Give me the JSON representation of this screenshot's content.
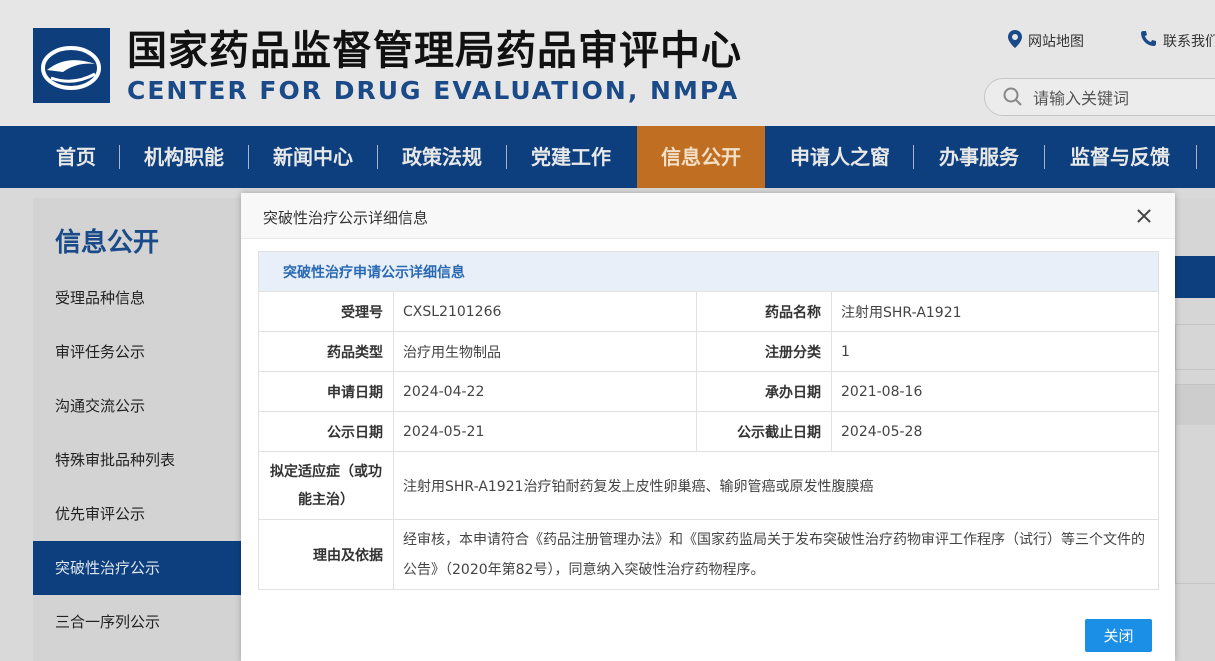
{
  "header": {
    "title_cn": "国家药品监督管理局药品审评中心",
    "title_en": "CENTER FOR DRUG EVALUATION, NMPA",
    "links": [
      {
        "label": "网站地图",
        "icon": "location-pin-icon"
      },
      {
        "label": "联系我们",
        "icon": "phone-icon"
      }
    ],
    "search": {
      "placeholder": "请输入关键词"
    }
  },
  "nav": {
    "items": [
      "首页",
      "机构职能",
      "新闻中心",
      "政策法规",
      "党建工作",
      "信息公开",
      "申请人之窗",
      "办事服务",
      "监督与反馈"
    ],
    "active": "信息公开"
  },
  "sidebar": {
    "title": "信息公开",
    "items": [
      "受理品种信息",
      "审评任务公示",
      "沟通交流公示",
      "特殊审批品种列表",
      "优先审评公示",
      "突破性治疗公示",
      "三合一序列公示"
    ],
    "active": "突破性治疗公示"
  },
  "modal": {
    "title": "突破性治疗公示详细信息",
    "caption": "突破性治疗申请公示详细信息",
    "fields": {
      "accept_no": {
        "label": "受理号",
        "value": "CXSL2101266"
      },
      "drug_name": {
        "label": "药品名称",
        "value": "注射用SHR-A1921"
      },
      "drug_type": {
        "label": "药品类型",
        "value": "治疗用生物制品"
      },
      "reg_class": {
        "label": "注册分类",
        "value": "1"
      },
      "apply_date": {
        "label": "申请日期",
        "value": "2024-04-22"
      },
      "handle_date": {
        "label": "承办日期",
        "value": "2021-08-16"
      },
      "publish_date": {
        "label": "公示日期",
        "value": "2024-05-21"
      },
      "publish_end": {
        "label": "公示截止日期",
        "value": "2024-05-28"
      },
      "indication": {
        "label": "拟定适应症（或功能主治）",
        "value": "注射用SHR-A1921治疗铂耐药复发上皮性卵巢癌、输卵管癌或原发性腹膜癌"
      },
      "reason": {
        "label": "理由及依据",
        "value": "经审核，本申请符合《药品注册管理办法》和《国家药监局关于发布突破性治疗药物审评工作程序（试行）等三个文件的公告》（2020年第82号），同意纳入突破性治疗药物程序。"
      }
    },
    "close_button": "关闭"
  },
  "colors": {
    "nav_bg": "#0d3f7e",
    "nav_active": "#c06f22",
    "caption_text": "#2a6ab5",
    "button": "#1b8fe6"
  }
}
